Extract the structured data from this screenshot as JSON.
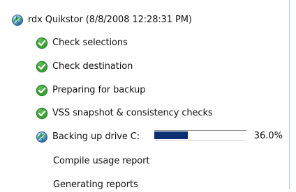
{
  "header": {
    "text": "rdx Quikstor (8/8/2008 12:28:31 PM)",
    "icon": "backup-status-icon"
  },
  "steps": [
    {
      "label": "Check selections",
      "icon": "check-circle-icon",
      "state": "complete"
    },
    {
      "label": "Check destination",
      "icon": "check-circle-icon",
      "state": "complete"
    },
    {
      "label": "Preparing for backup",
      "icon": "check-circle-icon",
      "state": "complete"
    },
    {
      "label": "VSS snapshot & consistency checks",
      "icon": "check-circle-icon",
      "state": "complete"
    },
    {
      "label": "Backing up drive C:",
      "icon": "backup-in-progress-icon",
      "state": "in-progress"
    },
    {
      "label": "Compile usage report",
      "icon": "",
      "state": "pending"
    },
    {
      "label": "Generating reports",
      "icon": "",
      "state": "pending"
    }
  ],
  "progress": {
    "percent": 36.0,
    "text": "36.0%",
    "fill_color": "#0b2f73"
  },
  "colors": {
    "success": "#3aa435",
    "success_dark": "#217c25",
    "progress": "#0b2f73",
    "border": "#b9c7d8"
  }
}
